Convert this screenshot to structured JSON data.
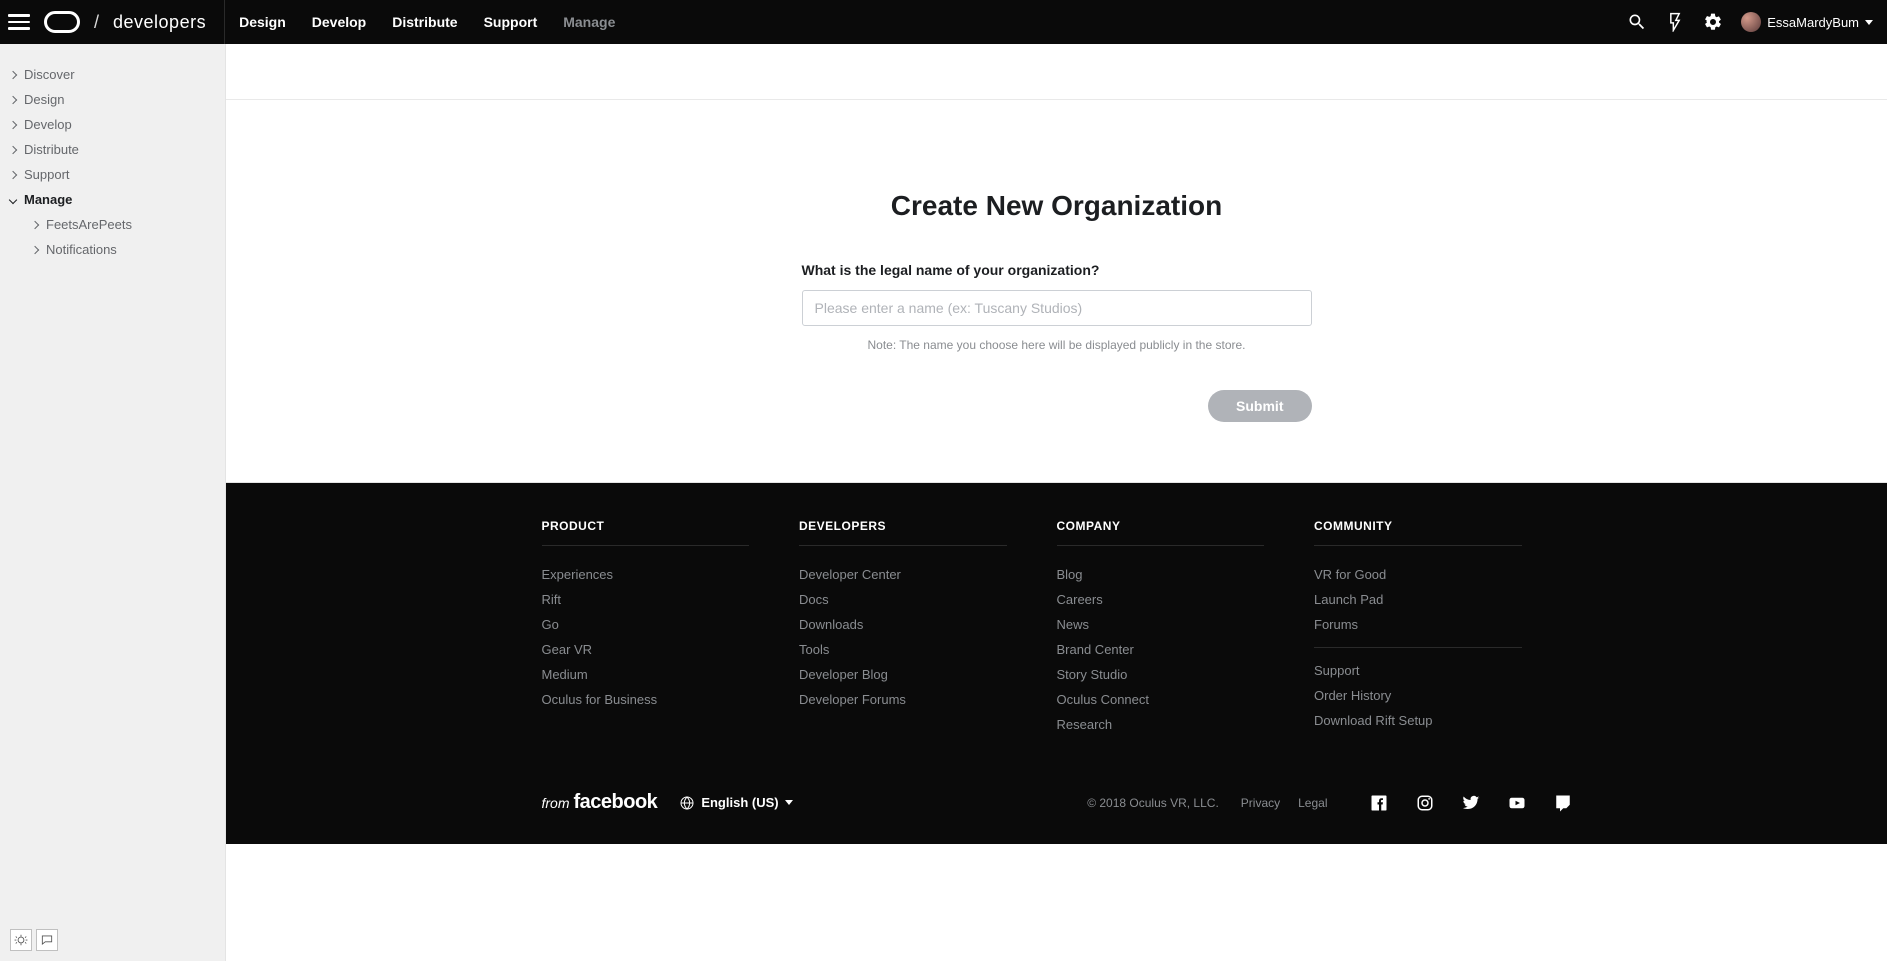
{
  "header": {
    "brand_text": "developers",
    "nav": [
      {
        "label": "Design",
        "active": true
      },
      {
        "label": "Develop",
        "active": true
      },
      {
        "label": "Distribute",
        "active": true
      },
      {
        "label": "Support",
        "active": true
      },
      {
        "label": "Manage",
        "active": false
      }
    ],
    "username": "EssaMardyBum"
  },
  "sidebar": {
    "items": [
      {
        "label": "Discover",
        "expanded": false,
        "active": false
      },
      {
        "label": "Design",
        "expanded": false,
        "active": false
      },
      {
        "label": "Develop",
        "expanded": false,
        "active": false
      },
      {
        "label": "Distribute",
        "expanded": false,
        "active": false
      },
      {
        "label": "Support",
        "expanded": false,
        "active": false
      },
      {
        "label": "Manage",
        "expanded": true,
        "active": true,
        "children": [
          {
            "label": "FeetsArePeets"
          },
          {
            "label": "Notifications"
          }
        ]
      }
    ]
  },
  "main": {
    "title": "Create New Organization",
    "form_label": "What is the legal name of your organization?",
    "placeholder": "Please enter a name (ex: Tuscany Studios)",
    "note": "Note: The name you choose here will be displayed publicly in the store.",
    "submit": "Submit"
  },
  "footer": {
    "cols": [
      {
        "title": "PRODUCT",
        "links": [
          "Experiences",
          "Rift",
          "Go",
          "Gear VR",
          "Medium",
          "Oculus for Business"
        ]
      },
      {
        "title": "DEVELOPERS",
        "links": [
          "Developer Center",
          "Docs",
          "Downloads",
          "Tools",
          "Developer Blog",
          "Developer Forums"
        ]
      },
      {
        "title": "COMPANY",
        "links": [
          "News",
          "Careers",
          "News",
          "Brand Center",
          "Story Studio",
          "Oculus Connect",
          "Research"
        ],
        "links_fixed": [
          "Blog",
          "Careers",
          "News",
          "Brand Center",
          "Story Studio",
          "Oculus Connect",
          "Research"
        ]
      },
      {
        "title": "COMMUNITY",
        "links": [
          "VR for Good",
          "Launch Pad",
          "Forums"
        ],
        "links2": [
          "Support",
          "Order History",
          "Download Rift Setup"
        ]
      }
    ],
    "from": "from",
    "fb": "facebook",
    "lang": "English (US)",
    "copyright": "© 2018 Oculus VR, LLC.",
    "legal_links": [
      "Privacy",
      "Legal"
    ]
  }
}
